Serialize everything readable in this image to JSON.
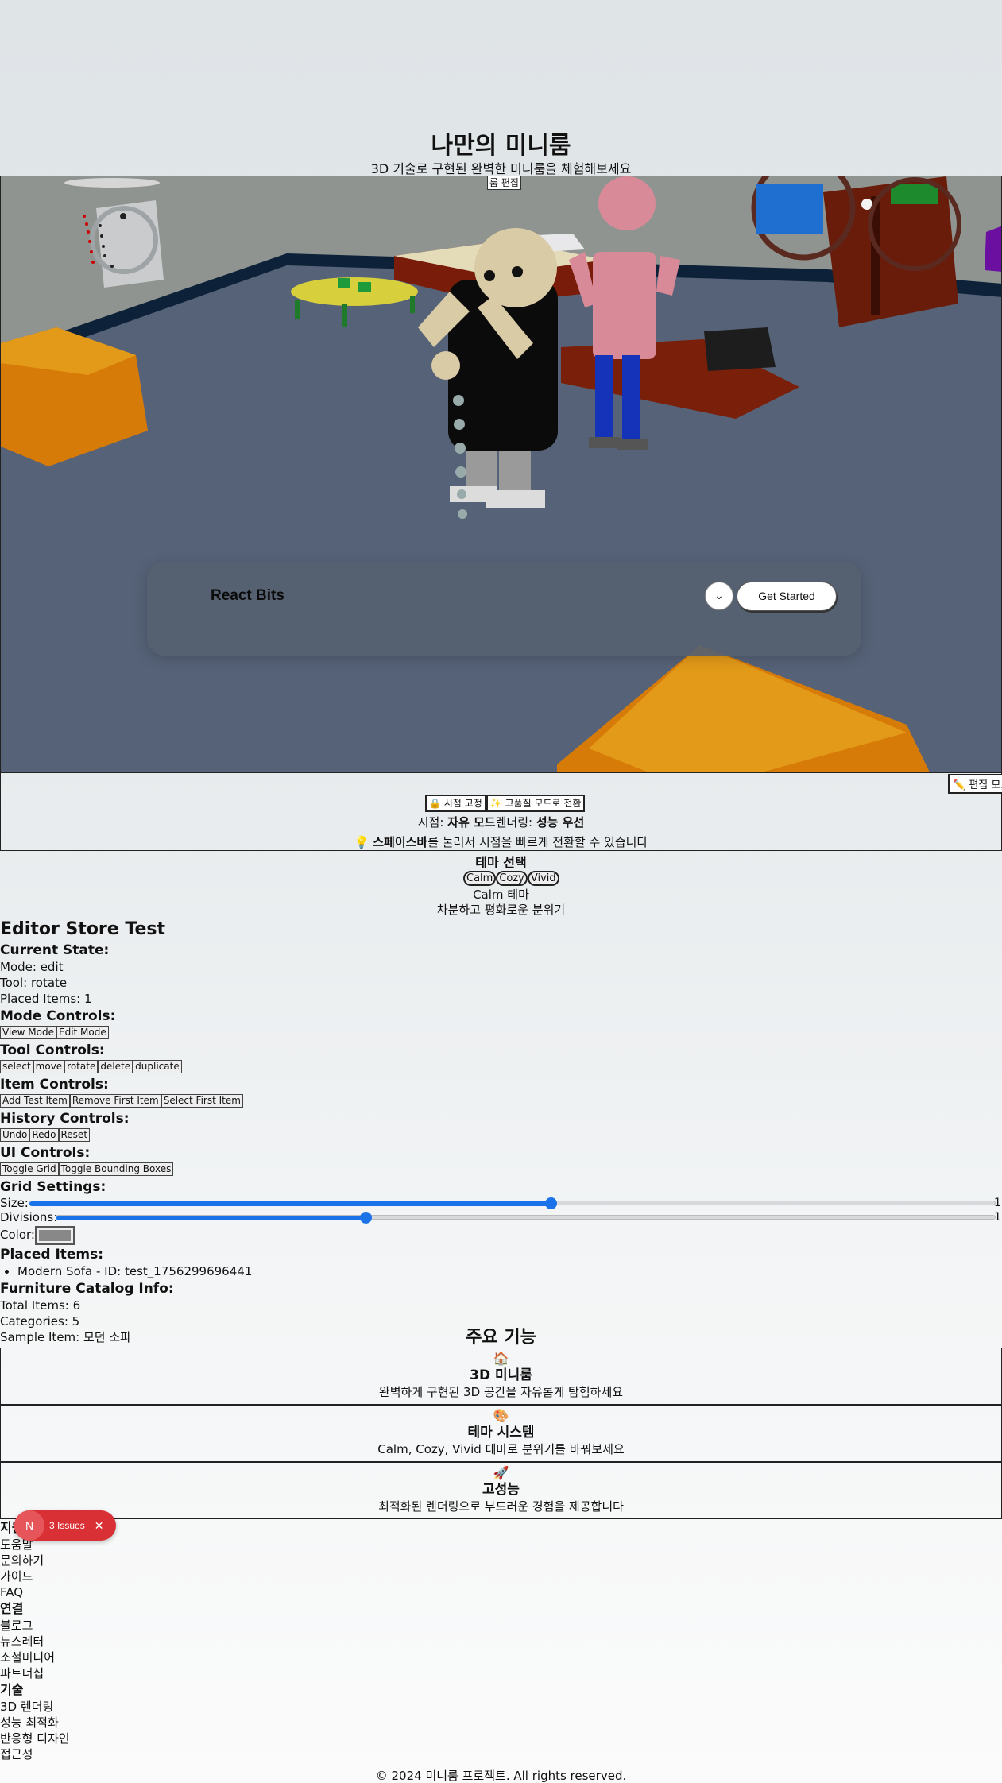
{
  "header": {
    "title": "나만의 미니룸",
    "subtitle": "3D 기술로 구현된 완벽한 미니룸을 체험해보세요",
    "room_edit_tag": "룸 편집"
  },
  "navbar": {
    "brand": "React Bits",
    "toggle_icon": "⌄",
    "cta_label": "Get Started"
  },
  "scene": {
    "edit_mode_button": "✏️ 편집 모드",
    "lock_view_button": "🔒 시점 고정",
    "quality_button": "✨ 고품질 모드로 전환",
    "view_label": "시점: ",
    "view_value": "자유 모드",
    "render_label": "렌더링: ",
    "render_value": "성능 우선",
    "hint_icon": "💡",
    "hint_bold": "스페이스바",
    "hint_rest": "를 눌러서 시점을 빠르게 전환할 수 있습니다"
  },
  "theme": {
    "title": "테마 선택",
    "options": [
      "Calm",
      "Cozy",
      "Vivid"
    ],
    "current_name": "Calm 테마",
    "current_desc": "차분하고 평화로운 분위기"
  },
  "editor": {
    "heading": "Editor Store Test",
    "current_state_title": "Current State:",
    "mode": "Mode: edit",
    "tool": "Tool: rotate",
    "placed_count": "Placed Items: 1",
    "mode_controls_title": "Mode Controls:",
    "mode_buttons": [
      "View Mode",
      "Edit Mode"
    ],
    "tool_controls_title": "Tool Controls:",
    "tool_buttons": [
      "select",
      "move",
      "rotate",
      "delete",
      "duplicate"
    ],
    "item_controls_title": "Item Controls:",
    "item_buttons": [
      "Add Test Item",
      "Remove First Item",
      "Select First Item"
    ],
    "history_controls_title": "History Controls:",
    "history_buttons": [
      "Undo",
      "Redo",
      "Reset"
    ],
    "ui_controls_title": "UI Controls:",
    "ui_buttons": [
      "Toggle Grid",
      "Toggle Bounding Boxes"
    ],
    "grid_settings_title": "Grid Settings:",
    "size_label": "Size:",
    "size_value": "1",
    "size_fraction": 0.54,
    "divisions_label": "Divisions:",
    "divisions_value": "1",
    "divisions_fraction": 0.33,
    "color_label": "Color:",
    "grid_color": "#888888",
    "placed_items_title": "Placed Items:",
    "placed_items": [
      "Modern Sofa - ID: test_1756299696441"
    ],
    "catalog_title": "Furniture Catalog Info:",
    "total_items": "Total Items: 6",
    "categories": "Categories: 5",
    "sample_item": "Sample Item: 모던 소파"
  },
  "features": {
    "title": "주요 기능",
    "items": [
      {
        "icon": "🏠",
        "title": "3D 미니룸",
        "desc": "완벽하게 구현된 3D 공간을 자유롭게 탐험하세요"
      },
      {
        "icon": "🎨",
        "title": "테마 시스템",
        "desc": "Calm, Cozy, Vivid 테마로 분위기를 바꿔보세요"
      },
      {
        "icon": "🚀",
        "title": "고성능",
        "desc": "최적화된 렌더링으로 부드러운 경험을 제공합니다"
      }
    ]
  },
  "footer": {
    "support_title": "지원",
    "support_links": [
      "도움말",
      "문의하기",
      "가이드",
      "FAQ"
    ],
    "connect_title": "연결",
    "connect_links": [
      "블로그",
      "뉴스레터",
      "소셜미디어",
      "파트너십"
    ],
    "tech_title": "기술",
    "tech_links": [
      "3D 렌더링",
      "성능 최적화",
      "반응형 디자인",
      "접근성"
    ],
    "copyright": "© 2024 미니룸 프로젝트. All rights reserved."
  },
  "devtools": {
    "badge_letter": "N",
    "issues_label": "3 Issues",
    "close_icon": "✕"
  },
  "colors": {
    "floor": "#566277",
    "wall": "#8f9490",
    "accent_blue": "#1a73e8",
    "issues_red": "#d93036"
  }
}
